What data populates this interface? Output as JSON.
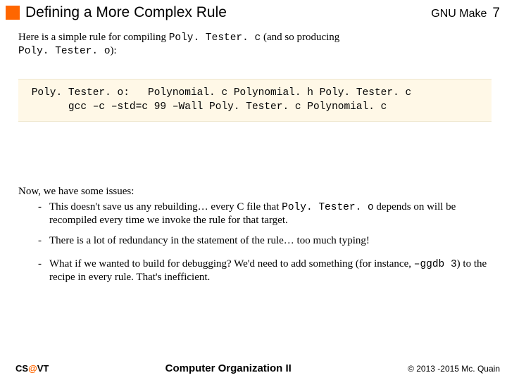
{
  "header": {
    "title": "Defining a More Complex Rule",
    "right_label": "GNU Make",
    "page_number": "7"
  },
  "intro": {
    "pre1": "Here is a simple rule for compiling ",
    "code1": "Poly. Tester. c",
    "mid1": " (and so producing",
    "code2": "Poly. Tester. o",
    "post1": "):"
  },
  "codeblock": " Poly. Tester. o:   Polynomial. c Polynomial. h Poly. Tester. c\n       gcc –c –std=c 99 –Wall Poly. Tester. c Polynomial. c",
  "issues": {
    "lead": "Now, we have some issues:",
    "b1_pre": "This doesn't save us any rebuilding… every C file that ",
    "b1_code": "Poly. Tester. o",
    "b1_post": " depends on will be recompiled every time we invoke the rule for that target.",
    "b2": "There is a lot of redundancy in the statement of the rule… too much typing!",
    "b3_pre": "What if we wanted to build for debugging?  We'd need to add something (for instance, ",
    "b3_code": "–ggdb 3",
    "b3_post": ") to the recipe in every rule.  That's inefficient."
  },
  "footer": {
    "left_cs": "CS",
    "left_at": "@",
    "left_vt": "VT",
    "center": "Computer Organization II",
    "right": "© 2013 -2015 Mc. Quain"
  }
}
